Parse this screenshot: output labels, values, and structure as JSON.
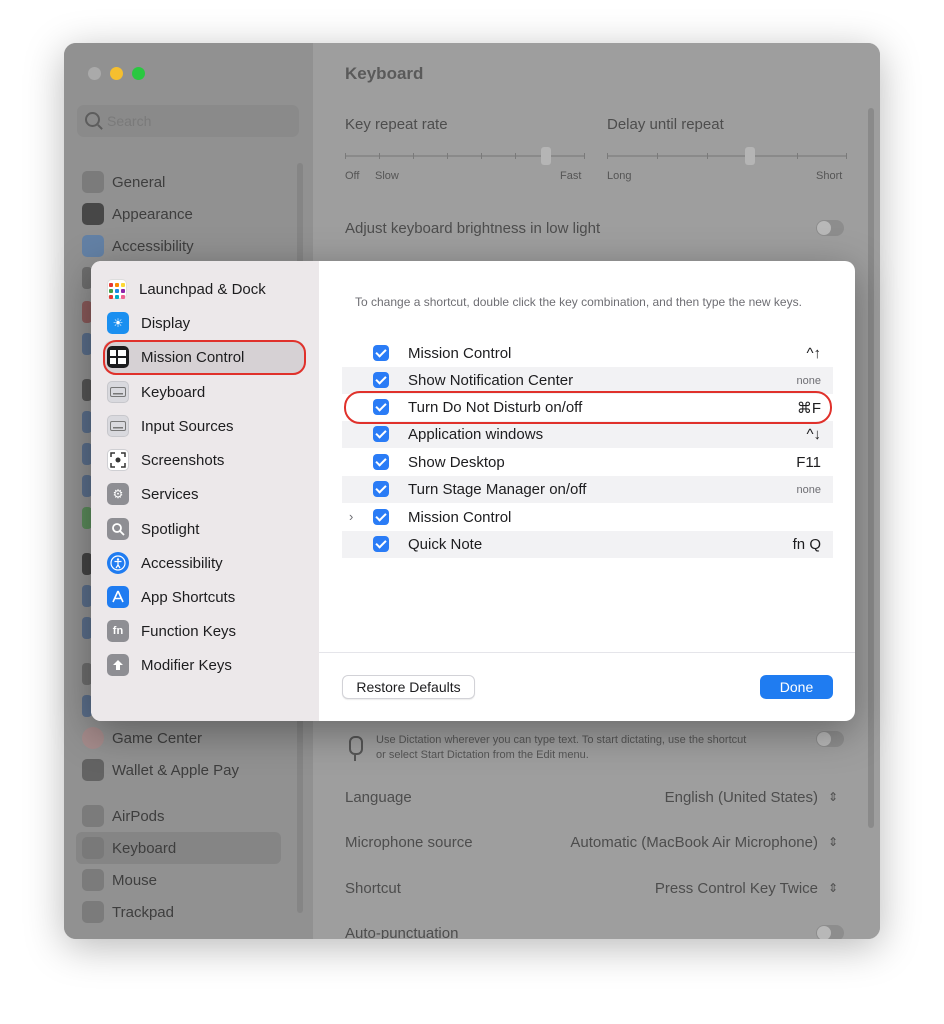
{
  "background": {
    "search_placeholder": "Search",
    "sidebar_items": [
      "General",
      "Appearance",
      "Accessibility",
      "Game Center",
      "Wallet & Apple Pay",
      "AirPods",
      "Keyboard",
      "Mouse",
      "Trackpad"
    ],
    "selected_item": "Keyboard",
    "main_title": "Keyboard",
    "key_repeat_rate": "Key repeat rate",
    "delay_until_repeat": "Delay until repeat",
    "scale_off": "Off",
    "scale_slow": "Slow",
    "scale_fast": "Fast",
    "scale_long": "Long",
    "scale_short": "Short",
    "adjust_brightness": "Adjust keyboard brightness in low light",
    "dictation_text_1": "Use Dictation wherever you can type text. To start dictating, use the shortcut",
    "dictation_text_2": "or select Start Dictation from the Edit menu.",
    "language_label": "Language",
    "language_value": "English (United States)",
    "mic_label": "Microphone source",
    "mic_value": "Automatic (MacBook Air Microphone)",
    "shortcut_label": "Shortcut",
    "shortcut_value": "Press Control Key Twice",
    "auto_punct_label": "Auto-punctuation"
  },
  "dialog": {
    "sidebar": [
      {
        "label": "Launchpad & Dock",
        "icon": "launchpad-icon"
      },
      {
        "label": "Display",
        "icon": "display-icon"
      },
      {
        "label": "Mission Control",
        "icon": "mission-control-icon",
        "selected": true
      },
      {
        "label": "Keyboard",
        "icon": "keyboard-icon"
      },
      {
        "label": "Input Sources",
        "icon": "input-sources-icon"
      },
      {
        "label": "Screenshots",
        "icon": "screenshots-icon"
      },
      {
        "label": "Services",
        "icon": "services-icon"
      },
      {
        "label": "Spotlight",
        "icon": "spotlight-icon"
      },
      {
        "label": "Accessibility",
        "icon": "accessibility-icon"
      },
      {
        "label": "App Shortcuts",
        "icon": "app-shortcuts-icon"
      },
      {
        "label": "Function Keys",
        "icon": "function-keys-icon"
      },
      {
        "label": "Modifier Keys",
        "icon": "modifier-keys-icon"
      }
    ],
    "instruction": "To change a shortcut, double click the key combination, and then type the new keys.",
    "shortcuts": [
      {
        "label": "Mission Control",
        "key": "^↑",
        "checked": true
      },
      {
        "label": "Show Notification Center",
        "key": "none",
        "checked": true
      },
      {
        "label": "Turn Do Not Disturb on/off",
        "key": "⌘F",
        "checked": true,
        "highlighted": true
      },
      {
        "label": "Application windows",
        "key": "^↓",
        "checked": true
      },
      {
        "label": "Show Desktop",
        "key": "F11",
        "checked": true
      },
      {
        "label": "Turn Stage Manager on/off",
        "key": "none",
        "checked": true
      },
      {
        "label": "Mission Control",
        "key": "",
        "checked": true,
        "expandable": true
      },
      {
        "label": "Quick Note",
        "key": "fn Q",
        "checked": true
      }
    ],
    "restore_label": "Restore Defaults",
    "done_label": "Done"
  },
  "colors": {
    "accent": "#1f7cf1",
    "highlight_ring": "#e0312b"
  }
}
